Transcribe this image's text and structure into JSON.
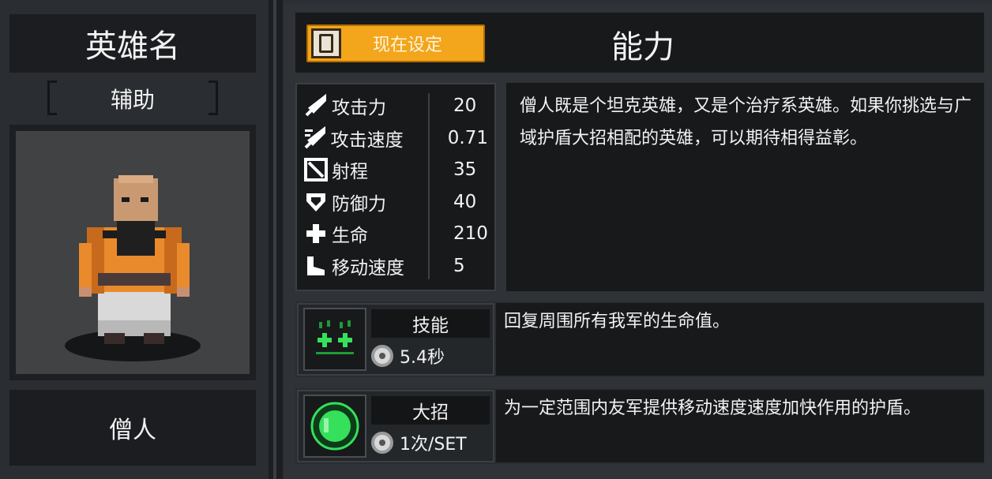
{
  "hero": {
    "title": "英雄名",
    "role": "辅助",
    "name": "僧人"
  },
  "header": {
    "set_button_label": "现在设定",
    "title": "能力"
  },
  "stats": [
    {
      "icon": "sword-icon",
      "label": "攻击力",
      "value": "20"
    },
    {
      "icon": "attack-speed-icon",
      "label": "攻击速度",
      "value": "0.71"
    },
    {
      "icon": "range-icon",
      "label": "射程",
      "value": "35"
    },
    {
      "icon": "shield-icon",
      "label": "防御力",
      "value": "40"
    },
    {
      "icon": "health-cross-icon",
      "label": "生命",
      "value": "210"
    },
    {
      "icon": "boot-icon",
      "label": "移动速度",
      "value": "5"
    }
  ],
  "description": "僧人既是个坦克英雄，又是个治疗系英雄。如果你挑选与广域护盾大招相配的英雄，可以期待相得益彰。",
  "skill": {
    "tag": "技能",
    "cooldown": "5.4秒",
    "description": "回复周围所有我军的生命值。",
    "icon": "heal-skill-icon"
  },
  "ultimate": {
    "tag": "大招",
    "uses": "1次/SET",
    "description": "为一定范围内友军提供移动速度速度加快作用的护盾。",
    "icon": "green-orb-icon"
  },
  "colors": {
    "accent_button": "#f3a51c",
    "panel_dark": "#17191b",
    "background": "#2c2f33",
    "skill_green": "#35e05a"
  }
}
